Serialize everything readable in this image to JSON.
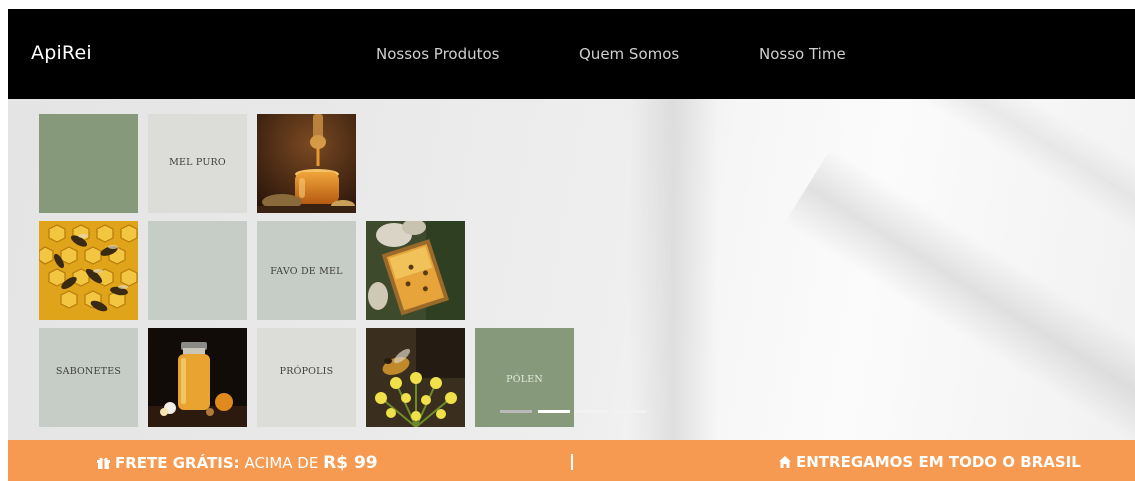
{
  "header": {
    "logo": "ApiRei",
    "nav": [
      {
        "label": "Nossos Produtos"
      },
      {
        "label": "Quem Somos"
      },
      {
        "label": "Nosso Time"
      }
    ]
  },
  "hero": {
    "tiles": {
      "mel_puro": "MEL PURO",
      "favo_de_mel": "FAVO DE MEL",
      "sabonetes": "SABONETES",
      "propolis": "PRÓPOLIS",
      "polen": "PÓLEN"
    },
    "images": {
      "honey_jar": "honey-jar-dipper-photo",
      "bees": "bees-on-honeycomb-photo",
      "frame": "beekeeper-honeycomb-frame-photo",
      "bottle": "honey-bottle-photo",
      "bee_flower": "bee-on-flower-photo"
    },
    "carousel": {
      "slides": 4,
      "active": 2
    }
  },
  "promo": {
    "free_shipping_label": "FRETE GRÁTIS:",
    "free_shipping_text": " ACIMA DE ",
    "free_shipping_value": "R$ 99",
    "delivery_text": "ENTREGAMOS EM TODO O BRASIL",
    "icons": [
      "gift-icon",
      "house-icon"
    ]
  },
  "colors": {
    "header_bg": "#000000",
    "promo_bg": "#f69a51",
    "tile_green": "#869a7b",
    "tile_grey": "#c6ccc6"
  }
}
